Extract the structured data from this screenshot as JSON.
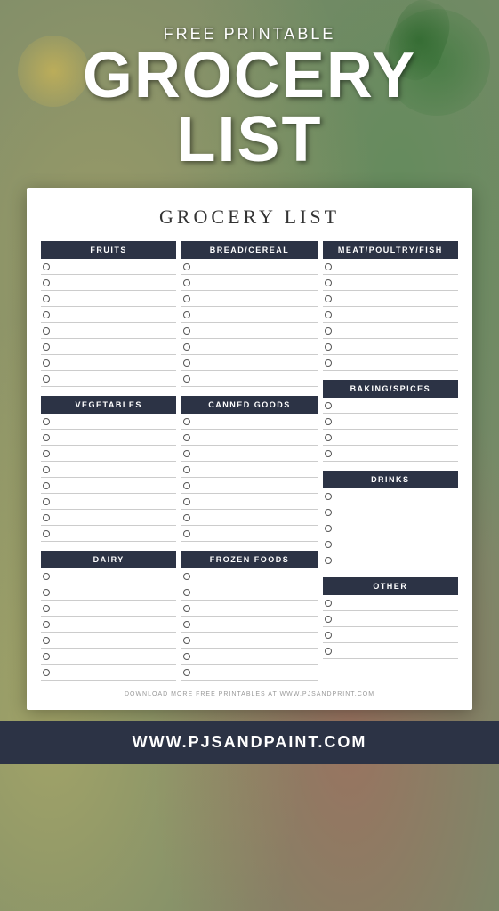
{
  "header": {
    "subtitle": "FREE PRINTABLE",
    "title_line1": "GROCERY",
    "title_line2": "LIST"
  },
  "card": {
    "title": "GROCERY LIST",
    "sections": {
      "col1_top": {
        "header": "FRUITS",
        "rows": 8
      },
      "col1_mid": {
        "header": "VEGETABLES",
        "rows": 8
      },
      "col1_bot": {
        "header": "DAIRY",
        "rows": 7
      },
      "col2_top": {
        "header": "BREAD/CEREAL",
        "rows": 8
      },
      "col2_mid": {
        "header": "CANNED GOODS",
        "rows": 8
      },
      "col2_bot": {
        "header": "FROZEN FOODS",
        "rows": 7
      },
      "col3_top": {
        "header": "MEAT/POULTRY/FISH",
        "rows": 7
      },
      "col3_baking": {
        "header": "BAKING/SPICES",
        "rows": 4
      },
      "col3_drinks": {
        "header": "DRINKS",
        "rows": 5
      },
      "col3_other": {
        "header": "OTHER",
        "rows": 4
      }
    },
    "footer_text": "DOWNLOAD MORE FREE PRINTABLES AT WWW.PJSANDPRINT.COM"
  },
  "footer": {
    "url": "WWW.PJSANDPAINT.COM"
  }
}
